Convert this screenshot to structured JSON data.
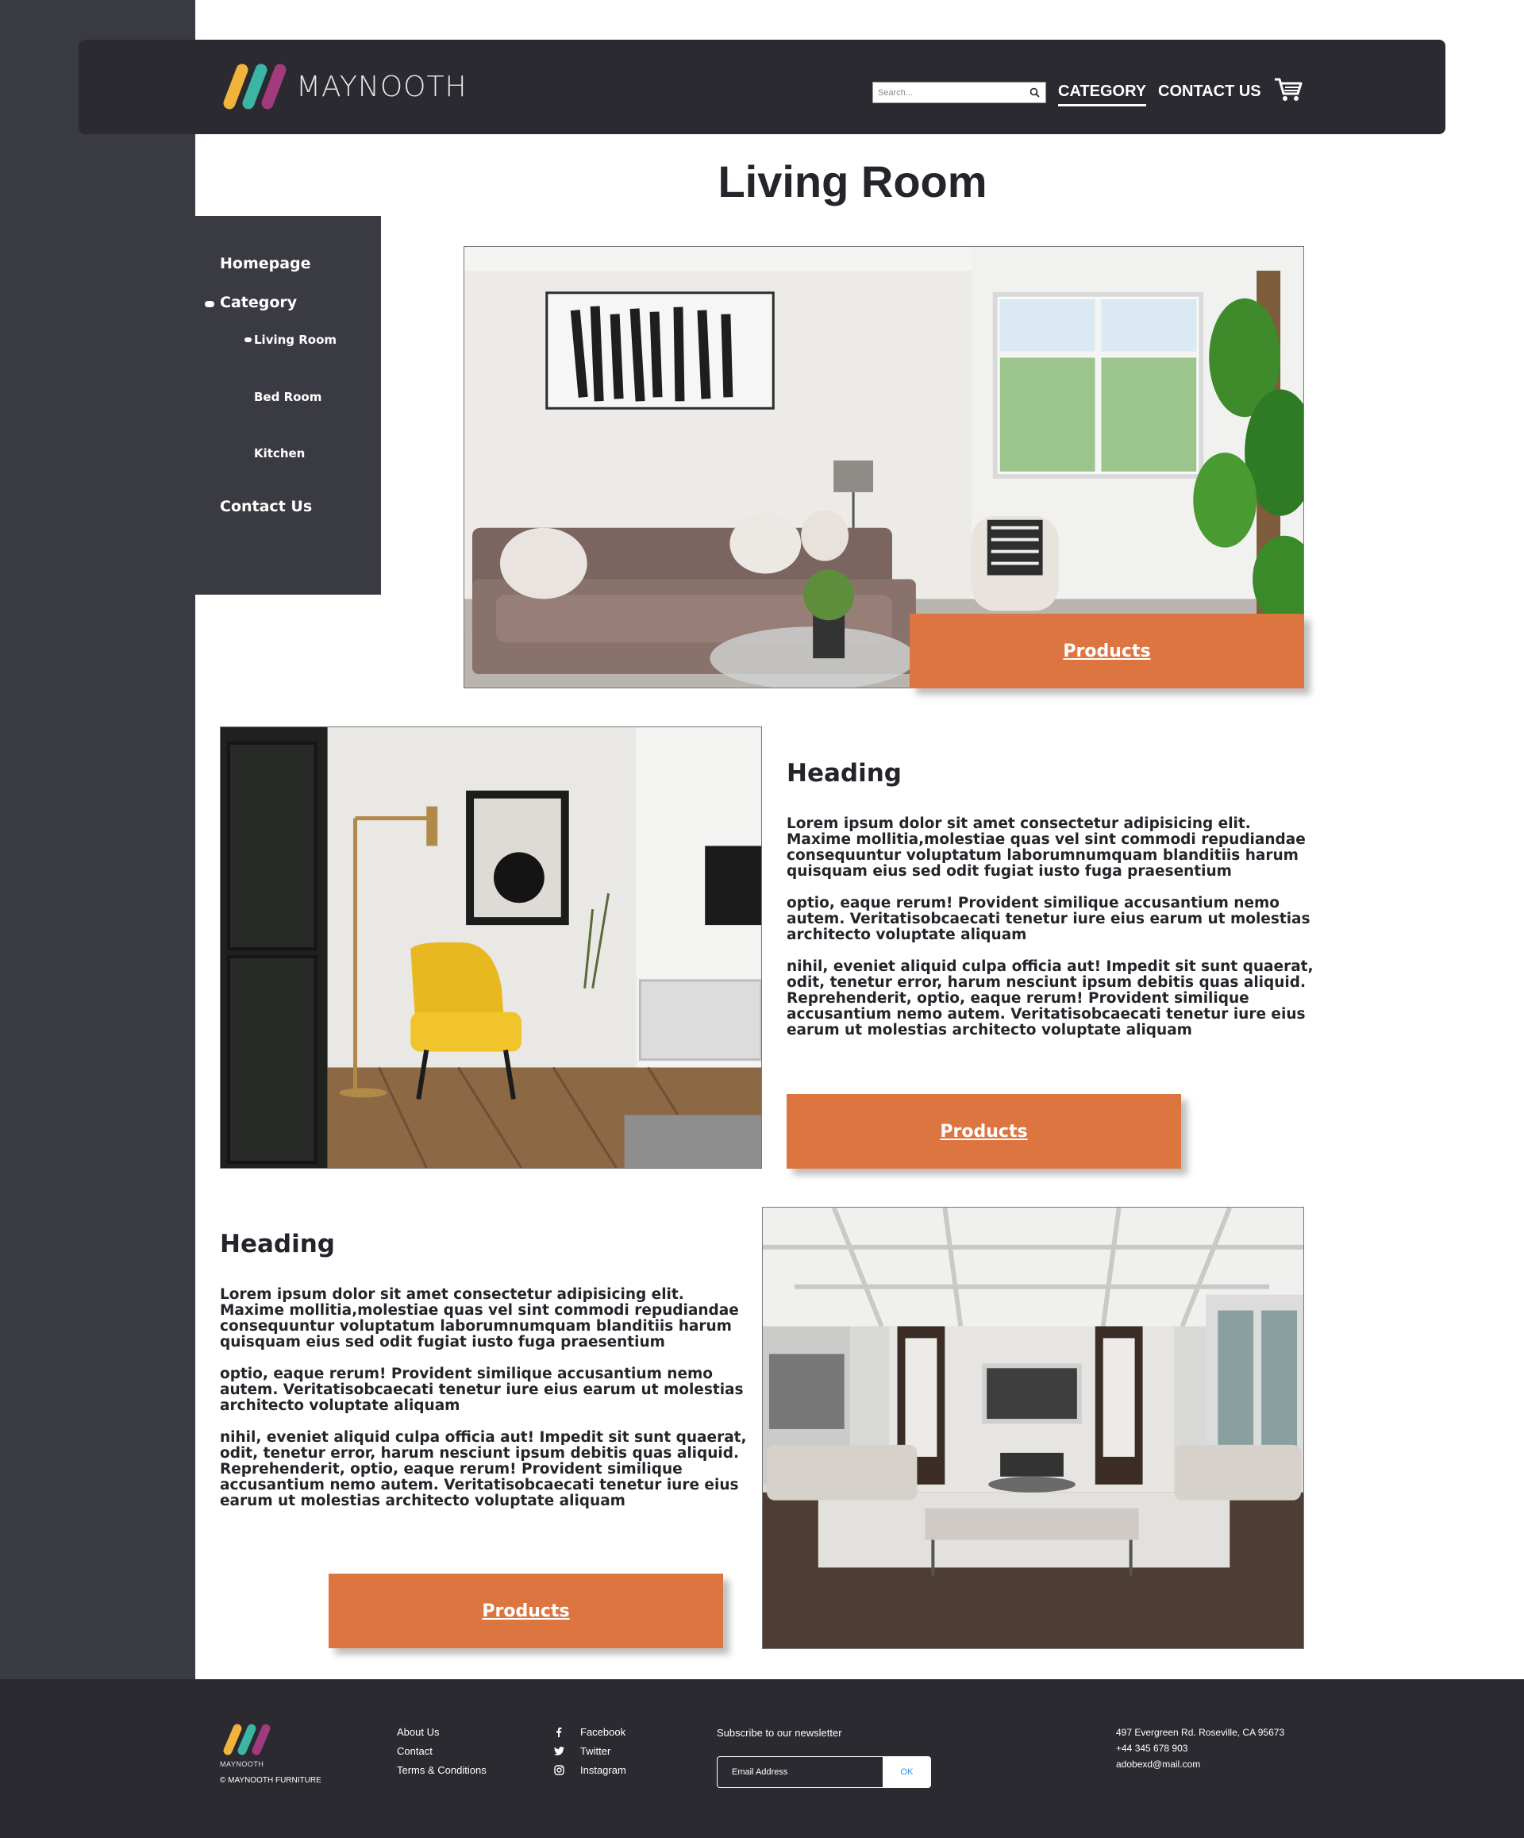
{
  "header": {
    "logo_text": "MAYNOOTH",
    "search_placeholder": "Search...",
    "nav_category": "CATEGORY",
    "nav_contact": "CONTACT US"
  },
  "page_title": "Living Room",
  "sidebar": {
    "homepage": "Homepage",
    "category": "Category",
    "living_room": "Living Room",
    "bed_room": "Bed Room",
    "kitchen": "Kitchen",
    "contact_us": "Contact Us"
  },
  "sections": [
    {
      "button": "Products"
    },
    {
      "heading": "Heading",
      "paragraphs": [
        "Lorem ipsum dolor sit amet consectetur adipisicing elit. Maxime mollitia,molestiae quas vel sint commodi repudiandae consequuntur voluptatum laborumnumquam blanditiis harum quisquam eius sed odit fugiat iusto fuga praesentium",
        "optio, eaque rerum! Provident similique accusantium nemo autem. Veritatisobcaecati tenetur iure eius earum ut molestias architecto voluptate aliquam",
        "nihil, eveniet aliquid culpa officia aut! Impedit sit sunt quaerat, odit, tenetur error, harum nesciunt ipsum debitis quas aliquid. Reprehenderit, optio, eaque rerum! Provident similique accusantium nemo autem. Veritatisobcaecati tenetur iure eius earum ut molestias architecto voluptate aliquam"
      ],
      "button": "Products"
    },
    {
      "heading": "Heading",
      "paragraphs": [
        "Lorem ipsum dolor sit amet consectetur adipisicing elit. Maxime mollitia,molestiae quas vel sint commodi repudiandae consequuntur voluptatum laborumnumquam blanditiis harum quisquam eius sed odit fugiat iusto fuga praesentium",
        "optio, eaque rerum! Provident similique accusantium nemo autem. Veritatisobcaecati tenetur iure eius earum ut molestias architecto voluptate aliquam",
        "nihil, eveniet aliquid culpa officia aut! Impedit sit sunt quaerat, odit, tenetur error, harum nesciunt ipsum debitis quas aliquid. Reprehenderit, optio, eaque rerum! Provident similique accusantium nemo autem. Veritatisobcaecati tenetur iure eius earum ut molestias architecto voluptate aliquam"
      ],
      "button": "Products"
    }
  ],
  "footer": {
    "logo_text": "MAYNOOTH",
    "copyright": "© MAYNOOTH FURNITURE",
    "links": [
      "About Us",
      "Contact",
      "Terms & Conditions"
    ],
    "social": [
      {
        "label": "Facebook",
        "icon": "facebook-icon"
      },
      {
        "label": "Twitter",
        "icon": "twitter-icon"
      },
      {
        "label": "Instagram",
        "icon": "instagram-icon"
      }
    ],
    "newsletter_title": "Subscribe to our newsletter",
    "email_placeholder": "Email Address",
    "ok_label": "OK",
    "address": "497 Evergreen Rd. Roseville, CA 95673",
    "phone": "+44 345 678 903",
    "email": "adobexd@mail.com"
  },
  "colors": {
    "accent": "#dd7541",
    "dark": "#2a2a30",
    "sidebar": "#3a3a42",
    "logo_yellow": "#f2b33d",
    "logo_teal": "#3bb5a4",
    "logo_purple": "#a23a7e"
  }
}
